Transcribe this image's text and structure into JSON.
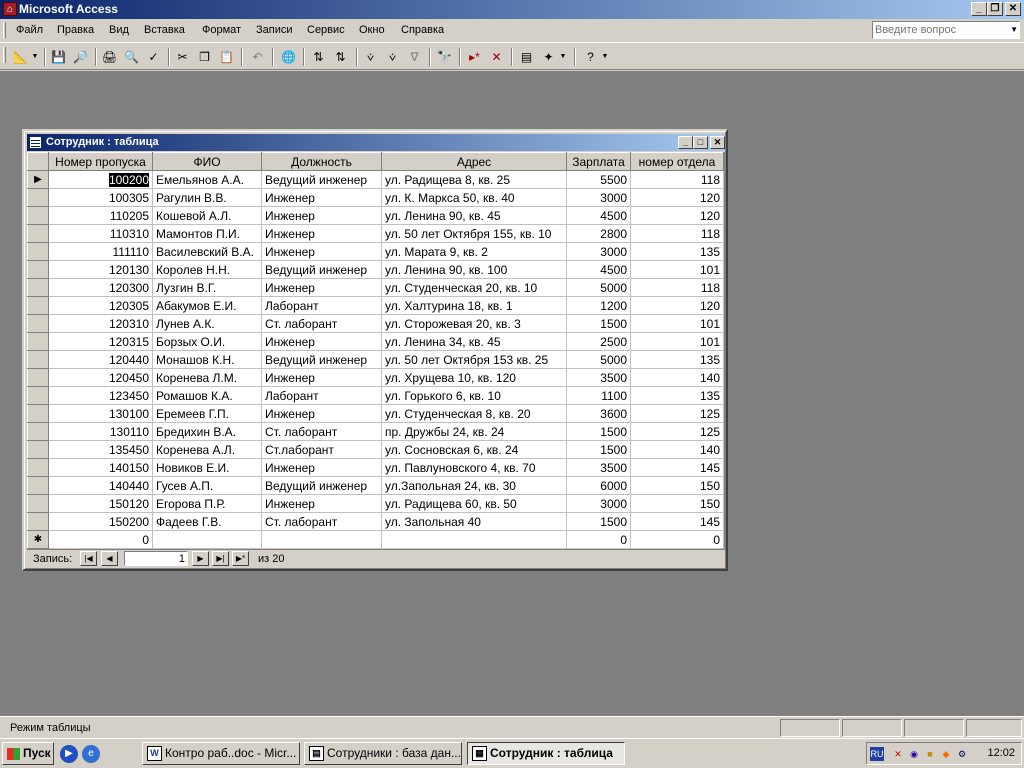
{
  "app": {
    "title": "Microsoft Access"
  },
  "menu": {
    "items": [
      "Файл",
      "Правка",
      "Вид",
      "Вставка",
      "Формат",
      "Записи",
      "Сервис",
      "Окно",
      "Справка"
    ],
    "help_placeholder": "Введите вопрос"
  },
  "child_window": {
    "title": "Сотрудник : таблица"
  },
  "table": {
    "columns": [
      "Номер пропуска",
      "ФИО",
      "Должность",
      "Адрес",
      "Зарплата",
      "номер отдела"
    ],
    "rows": [
      [
        "100200",
        "Емельянов А.А.",
        "Ведущий инженер",
        "ул. Радищева 8, кв. 25",
        "5500",
        "118"
      ],
      [
        "100305",
        "Рагулин В.В.",
        "Инженер",
        "ул. К. Маркса 50, кв. 40",
        "3000",
        "120"
      ],
      [
        "110205",
        "Кошевой А.Л.",
        "Инженер",
        "ул. Ленина 90, кв. 45",
        "4500",
        "120"
      ],
      [
        "110310",
        "Мамонтов П.И.",
        "Инженер",
        "ул. 50 лет Октября 155, кв. 10",
        "2800",
        "118"
      ],
      [
        "111110",
        "Василевский В.А.",
        "Инженер",
        "ул. Марата 9, кв. 2",
        "3000",
        "135"
      ],
      [
        "120130",
        "Королев Н.Н.",
        "Ведущий инженер",
        "ул. Ленина 90, кв. 100",
        "4500",
        "101"
      ],
      [
        "120300",
        "Лузгин В.Г.",
        "Инженер",
        "ул. Студенческая 20, кв. 10",
        "5000",
        "118"
      ],
      [
        "120305",
        "Абакумов Е.И.",
        "Лаборант",
        "ул. Халтурина 18, кв. 1",
        "1200",
        "120"
      ],
      [
        "120310",
        "Лунев А.К.",
        "Ст. лаборант",
        "ул. Сторожевая 20, кв. 3",
        "1500",
        "101"
      ],
      [
        "120315",
        "Борзых О.И.",
        "Инженер",
        "ул. Ленина 34, кв. 45",
        "2500",
        "101"
      ],
      [
        "120440",
        "Монашов К.Н.",
        "Ведущий инженер",
        "ул. 50 лет Октября 153 кв. 25",
        "5000",
        "135"
      ],
      [
        "120450",
        "Коренева Л.М.",
        "Инженер",
        "ул. Хрущева 10, кв. 120",
        "3500",
        "140"
      ],
      [
        "123450",
        "Ромашов К.А.",
        "Лаборант",
        "ул. Горького 6, кв. 10",
        "1100",
        "135"
      ],
      [
        "130100",
        "Еремеев Г.П.",
        "Инженер",
        "ул. Студенческая 8, кв. 20",
        "3600",
        "125"
      ],
      [
        "130110",
        "Бредихин В.А.",
        "Ст. лаборант",
        "пр. Дружбы 24, кв. 24",
        "1500",
        "125"
      ],
      [
        "135450",
        "Коренева А.Л.",
        "Ст.лаборант",
        "ул. Сосновская 6, кв. 24",
        "1500",
        "140"
      ],
      [
        "140150",
        "Новиков Е.И.",
        "Инженер",
        "ул. Павлуновского 4, кв. 70",
        "3500",
        "145"
      ],
      [
        "140440",
        "Гусев А.П.",
        "Ведущий инженер",
        "ул.Запольная 24, кв. 30",
        "6000",
        "150"
      ],
      [
        "150120",
        "Егорова П.Р.",
        "Инженер",
        "ул. Радищева 60, кв. 50",
        "3000",
        "150"
      ],
      [
        "150200",
        "Фадеев Г.В.",
        "Ст. лаборант",
        "ул. Запольная 40",
        "1500",
        "145"
      ]
    ],
    "new_row": [
      "0",
      "",
      "",
      "",
      "0",
      "0"
    ]
  },
  "navigation": {
    "label": "Запись:",
    "current": "1",
    "of_label": "из  20"
  },
  "status": {
    "text": "Режим таблицы"
  },
  "taskbar": {
    "start_label": "Пуск",
    "tasks": [
      "Контро раб..doc - Micr...",
      "Сотрудники : база дан...",
      "Сотрудник : таблица"
    ],
    "lang": "RU",
    "clock": "12:02"
  }
}
